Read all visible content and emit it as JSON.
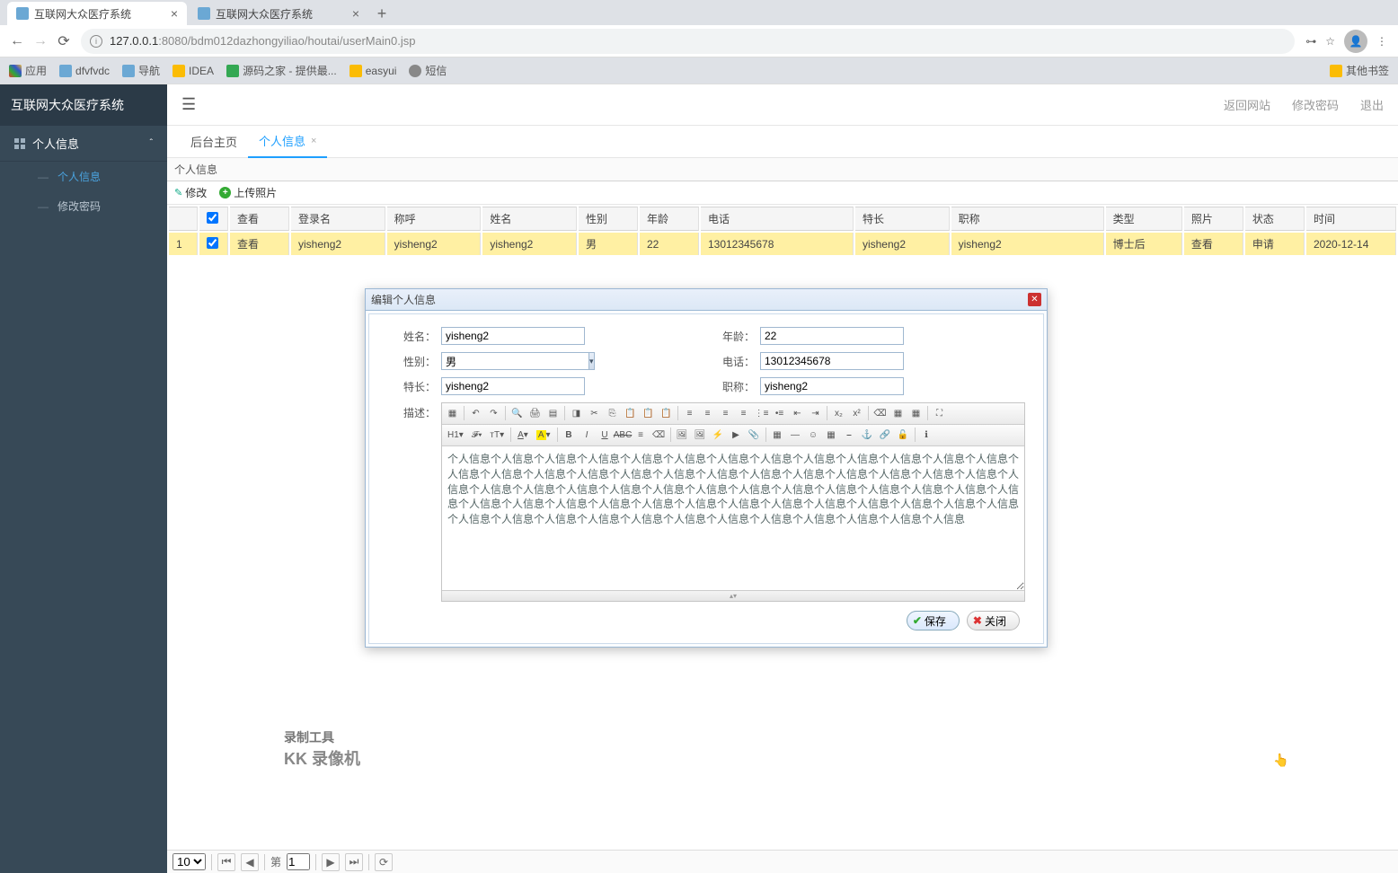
{
  "browser": {
    "tabs": [
      {
        "title": "互联网大众医疗系统",
        "active": true
      },
      {
        "title": "互联网大众医疗系统",
        "active": false
      }
    ],
    "url_host": "127.0.0.1",
    "url_port": ":8080",
    "url_path": "/bdm012dazhongyiliao/houtai/userMain0.jsp",
    "bookmarks": {
      "apps": "应用",
      "items": [
        "dfvfvdc",
        "导航",
        "IDEA",
        "源码之家 - 提供最...",
        "easyui",
        "短信"
      ],
      "other": "其他书签"
    }
  },
  "app": {
    "title": "互联网大众医疗系统",
    "top_actions": [
      "返回网站",
      "修改密码",
      "退出"
    ],
    "nav": {
      "group": "个人信息",
      "items": [
        "个人信息",
        "修改密码"
      ]
    },
    "page_tabs": {
      "home": "后台主页",
      "active": "个人信息"
    },
    "panel_title": "个人信息",
    "toolbar": {
      "edit": "修改",
      "upload": "上传照片"
    },
    "grid": {
      "headers": {
        "view": "查看",
        "login": "登录名",
        "称呼": "称呼",
        "name": "姓名",
        "gender": "性别",
        "age": "年龄",
        "phone": "电话",
        "specialty": "特长",
        "title": "职称",
        "type": "类型",
        "photo": "照片",
        "status": "状态",
        "time": "时间"
      },
      "row": {
        "idx": "1",
        "view": "查看",
        "login": "yisheng2",
        "称呼": "yisheng2",
        "name": "yisheng2",
        "gender": "男",
        "age": "22",
        "phone": "13012345678",
        "specialty": "yisheng2",
        "title": "yisheng2",
        "type": "博士后",
        "photo": "查看",
        "status": "申请",
        "time": "2020-12-14"
      }
    }
  },
  "dialog": {
    "title": "编辑个人信息",
    "fields": {
      "name_label": "姓名：",
      "name_value": "yisheng2",
      "age_label": "年龄：",
      "age_value": "22",
      "gender_label": "性别：",
      "gender_value": "男",
      "phone_label": "电话：",
      "phone_value": "13012345678",
      "specialty_label": "特长：",
      "specialty_value": "yisheng2",
      "title_label": "职称：",
      "title_value": "yisheng2",
      "desc_label": "描述："
    },
    "editor_text": "个人信息个人信息个人信息个人信息个人信息个人信息个人信息个人信息个人信息个人信息个人信息个人信息个人信息个人信息个人信息个人信息个人信息个人信息个人信息个人信息个人信息个人信息个人信息个人信息个人信息个人信息个人信息个人信息个人信息个人信息个人信息个人信息个人信息个人信息个人信息个人信息个人信息个人信息个人信息个人信息个人信息个人信息个人信息个人信息个人信息个人信息个人信息个人信息个人信息个人信息个人信息个人信息个人信息个人信息个人信息个人信息个人信息个人信息个人信息个人信息个人信息个人信息个人信息个人信息个人信息",
    "save": "保存",
    "close": "关闭"
  },
  "watermark": {
    "l1": "录制工具",
    "l2": "KK 录像机"
  },
  "pager": {
    "page": "1"
  }
}
